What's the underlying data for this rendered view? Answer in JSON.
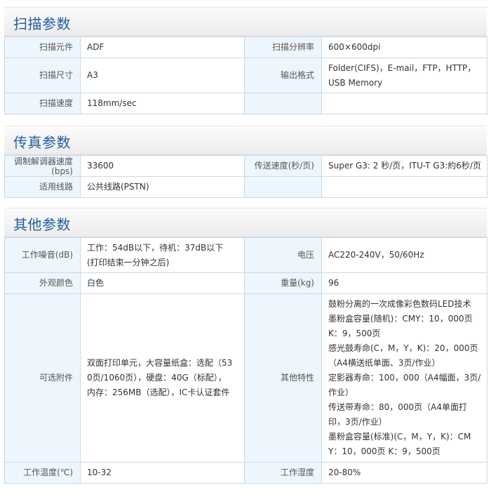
{
  "sections": {
    "scan": {
      "title": "扫描参数",
      "element_label": "扫描元件",
      "element_value": "ADF",
      "resolution_label": "扫描分辨率",
      "resolution_value": "600×600dpi",
      "size_label": "扫描尺寸",
      "size_value": "A3",
      "format_label": "输出格式",
      "format_value": "Folder(CIFS)，E-mail，FTP，HTTP，\nUSB Memory",
      "speed_label": "扫描速度",
      "speed_value": "118mm/sec"
    },
    "fax": {
      "title": "传真参数",
      "modem_label": "调制解调器速度\n(bps)",
      "modem_value": "33600",
      "transfer_label": "传送速度(秒/页)",
      "transfer_value": "Super G3: 2 秒/页，ITU-T G3:約6秒/页",
      "line_label": "适用线路",
      "line_value": "公共线路(PSTN)"
    },
    "other": {
      "title": "其他参数",
      "noise_label": "工作噪音(dB)",
      "noise_value": "工作：54dB以下，待机：37dB以下\n(打印结束一分钟之后)",
      "voltage_label": "电压",
      "voltage_value": "AC220-240V，50/60Hz",
      "color_label": "外观颜色",
      "color_value": "白色",
      "weight_label": "重量(kg)",
      "weight_value": "96",
      "options_label": "可选附件",
      "options_value": "双面打印单元，大容量纸盒：选配（53\n0页/1060页），硬盘：40G（标配），\n内存：256MB（选配），IC卡认证套件",
      "features_label": "其他特性",
      "features_value": "鼓粉分离的一次成像彩色数码LED技术\n墨粉盒容量(随机)：CMY：10，000页\nK：9，500页\n感光鼓寿命(C，M，Y，K)：20，000页\n（A4横送纸单面、3页/作业）\n定影器寿命：100，000（A4幅面，3页/\n作业）\n传送带寿命：80，000页（A4单面打\n印，3页/作业）\n墨粉盒容量(标准)(C，M，Y，K)：CM\nY：10，000页 K：9，500页",
      "temp_label": "工作温度(℃)",
      "temp_value": "10-32",
      "humidity_label": "工作湿度",
      "humidity_value": "20-80%"
    }
  }
}
